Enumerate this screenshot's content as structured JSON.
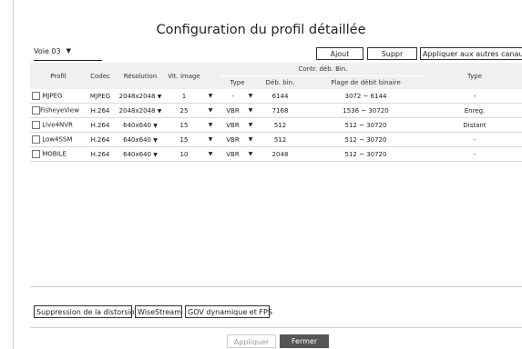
{
  "title": "Configuration du profil détaillée",
  "channel": {
    "value": "Voie 03"
  },
  "toolbar": {
    "add_label": "Ajout",
    "delete_label": "Suppr",
    "apply_others_label": "Appliquer aux autres canaux"
  },
  "table": {
    "headers": {
      "profile": "Profil",
      "codec": "Codec",
      "resolution": "Résolution",
      "framerate": "Vit. image",
      "bitrate_control": "Contr. déb. Bin.",
      "type": "Type",
      "bitrate": "Déb. bin.",
      "bitrate_range": "Plage de débit binaire",
      "type2": "Type"
    },
    "rows": [
      {
        "profile": "MJPEG",
        "codec": "MJPEG",
        "resolution": "2048x2048",
        "framerate": "1",
        "type": "-",
        "bitrate": "6144",
        "range": "3072 ~ 6144",
        "type2": "-"
      },
      {
        "profile": "FisheyeView",
        "codec": "H.264",
        "resolution": "2048x2048",
        "framerate": "25",
        "type": "VBR",
        "bitrate": "7168",
        "range": "1536 ~ 30720",
        "type2": "Enreg."
      },
      {
        "profile": "Live4NVR",
        "codec": "H.264",
        "resolution": "640x640",
        "framerate": "15",
        "type": "VBR",
        "bitrate": "512",
        "range": "512 ~ 30720",
        "type2": "Distant"
      },
      {
        "profile": "Low4SSM",
        "codec": "H.264",
        "resolution": "640x640",
        "framerate": "15",
        "type": "VBR",
        "bitrate": "512",
        "range": "512 ~ 30720",
        "type2": "-"
      },
      {
        "profile": "MOBILE",
        "codec": "H.264",
        "resolution": "640x640",
        "framerate": "10",
        "type": "VBR",
        "bitrate": "2048",
        "range": "512 ~ 30720",
        "type2": "-"
      }
    ]
  },
  "options": {
    "dewarp_label": "Suppression de la distorsion",
    "wisestream_label": "WiseStream",
    "gov_label": "GOV dynamique et FPS"
  },
  "footer": {
    "apply_label": "Appliquer",
    "close_label": "Fermer"
  },
  "icons": {
    "dropdown": "caret-down-icon",
    "checkbox": "checkbox-icon"
  },
  "colors": {
    "close_bg": "#555555",
    "header_bg": "#f0f0f0"
  }
}
